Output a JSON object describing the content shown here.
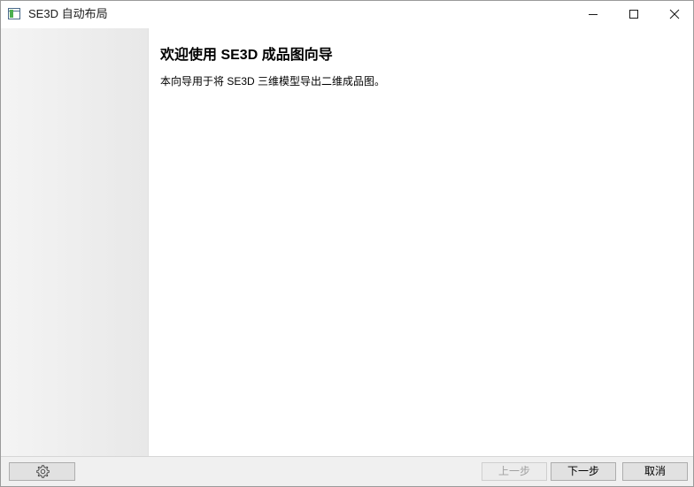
{
  "window": {
    "title": "SE3D 自动布局",
    "icon": "app-window-icon",
    "controls": {
      "minimize_icon": "minimize-icon",
      "maximize_icon": "maximize-icon",
      "close_icon": "close-icon"
    }
  },
  "wizard": {
    "heading": "欢迎使用 SE3D 成品图向导",
    "description": "本向导用于将 SE3D 三维模型导出二维成品图。"
  },
  "footer": {
    "settings_icon": "gear-icon",
    "prev_label": "上一步",
    "prev_enabled": false,
    "next_label": "下一步",
    "cancel_label": "取消"
  },
  "colors": {
    "sidebar": "#ececec",
    "footer": "#f0f0f0",
    "button": "#e1e1e1",
    "disabled_text": "#a0a0a0"
  }
}
